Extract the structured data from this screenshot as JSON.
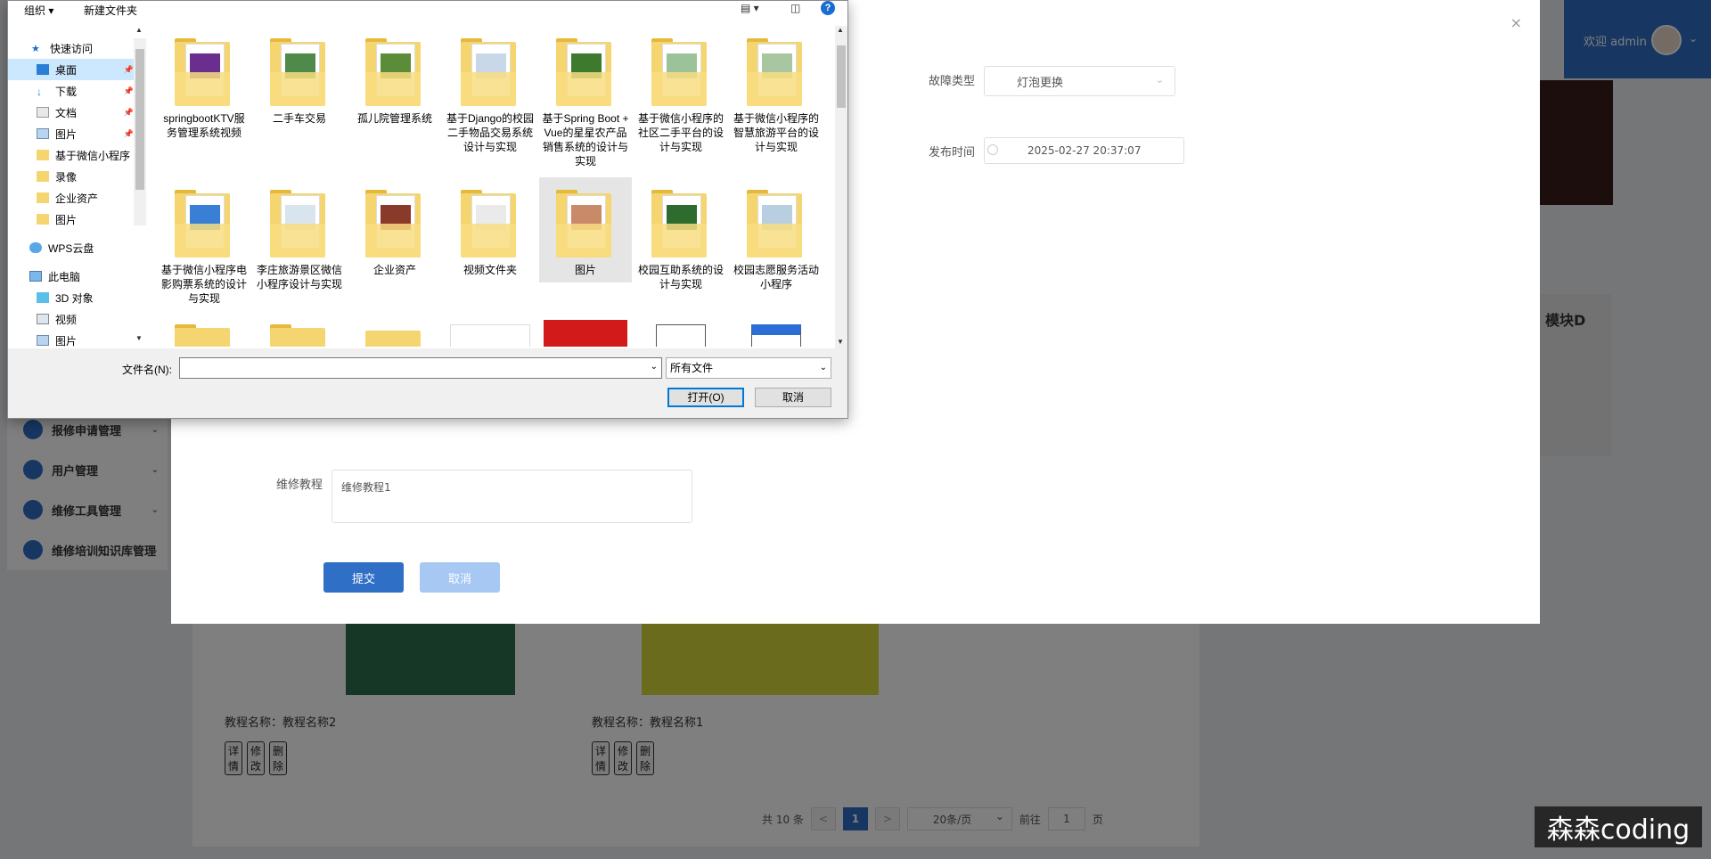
{
  "header": {
    "welcome": "欢迎 admin",
    "chevron": "⌄"
  },
  "sidebar": {
    "items": [
      {
        "label": "报修申请管理"
      },
      {
        "label": "用户管理"
      },
      {
        "label": "维修工具管理"
      },
      {
        "label": "维修培训知识库管理"
      }
    ]
  },
  "form": {
    "fault_type_label": "故障类型",
    "fault_type_value": "灯泡更换",
    "publish_time_label": "发布时间",
    "publish_time_value": "2025-02-27 20:37:07",
    "tutorial_label": "维修教程",
    "tutorial_value": "维修教程1",
    "submit_label": "提交",
    "cancel_label": "取消",
    "close": "×"
  },
  "cards": [
    {
      "name": "教程名称：教程名称2",
      "buttons": [
        "详情",
        "修改",
        "删除"
      ]
    },
    {
      "name": "教程名称：教程名称1",
      "buttons": [
        "详情",
        "修改",
        "删除"
      ]
    }
  ],
  "right_book_title": "模块D",
  "pagination": {
    "total": "共 10 条",
    "prev": "<",
    "current": "1",
    "next": ">",
    "page_size": "20条/页",
    "goto_label": "前往",
    "goto_value": "1",
    "page_suffix": "页"
  },
  "file_dialog": {
    "toolbar": {
      "organize": "组织 ▾",
      "new_folder": "新建文件夹",
      "help": "?"
    },
    "nav": [
      {
        "label": "快速访问",
        "icon": "star-icon",
        "pinned": false
      },
      {
        "label": "桌面",
        "icon": "desktop-icon",
        "pinned": true,
        "selected": true
      },
      {
        "label": "下载",
        "icon": "download-icon",
        "pinned": true
      },
      {
        "label": "文档",
        "icon": "document-icon",
        "pinned": true
      },
      {
        "label": "图片",
        "icon": "picture-icon",
        "pinned": true
      },
      {
        "label": "基于微信小程序",
        "icon": "folder-icon",
        "pinned": false
      },
      {
        "label": "录像",
        "icon": "folder-icon",
        "pinned": false
      },
      {
        "label": "企业资产",
        "icon": "folder-icon",
        "pinned": false
      },
      {
        "label": "图片",
        "icon": "folder-icon",
        "pinned": false
      },
      {
        "label": "WPS云盘",
        "icon": "cloud-icon",
        "pinned": false
      },
      {
        "label": "此电脑",
        "icon": "computer-icon",
        "pinned": false
      },
      {
        "label": "3D 对象",
        "icon": "cube-icon",
        "pinned": false
      },
      {
        "label": "视频",
        "icon": "video-icon",
        "pinned": false
      },
      {
        "label": "图片",
        "icon": "picture-icon",
        "pinned": false
      }
    ],
    "files": [
      {
        "name": "springbootKTV服务管理系统视频"
      },
      {
        "name": "二手车交易"
      },
      {
        "name": "孤儿院管理系统"
      },
      {
        "name": "基于Django的校园二手物品交易系统设计与实现"
      },
      {
        "name": "基于Spring Boot + Vue的星星农产品销售系统的设计与实现"
      },
      {
        "name": "基于微信小程序的社区二手平台的设计与实现"
      },
      {
        "name": "基于微信小程序的智慧旅游平台的设计与实现"
      },
      {
        "name": "基于微信小程序电影购票系统的设计与实现"
      },
      {
        "name": "李庄旅游景区微信小程序设计与实现"
      },
      {
        "name": "企业资产"
      },
      {
        "name": "视频文件夹"
      },
      {
        "name": "图片"
      },
      {
        "name": "校园互助系统的设计与实现"
      },
      {
        "name": "校园志愿服务活动小程序"
      }
    ],
    "filename_label": "文件名(N):",
    "filename_value": "",
    "filetype_value": "所有文件",
    "open_label": "打开(O)",
    "cancel_label": "取消"
  },
  "watermark": "森森coding"
}
